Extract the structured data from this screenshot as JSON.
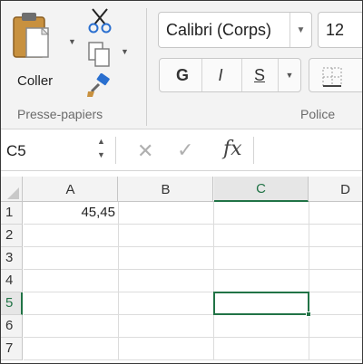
{
  "ribbon": {
    "clipboard": {
      "paste_label": "Coller",
      "group_label": "Presse-papiers",
      "icons": [
        "clipboard-icon",
        "scissors-icon",
        "copy-icon",
        "format-painter-icon"
      ]
    },
    "font": {
      "font_name": "Calibri (Corps)",
      "font_size": "12",
      "bold_label": "G",
      "italic_label": "I",
      "underline_label": "S",
      "group_label": "Police"
    }
  },
  "formula_bar": {
    "name_box": "C5",
    "fx_label": "fx",
    "value": ""
  },
  "sheet": {
    "columns": [
      "A",
      "B",
      "C",
      "D"
    ],
    "rows": [
      "1",
      "2",
      "3",
      "4",
      "5",
      "6",
      "7"
    ],
    "active_cell": "C5",
    "cells": {
      "A1": "45,45"
    }
  },
  "colors": {
    "accent": "#217346",
    "ribbon_bg": "#f3f3f3"
  }
}
